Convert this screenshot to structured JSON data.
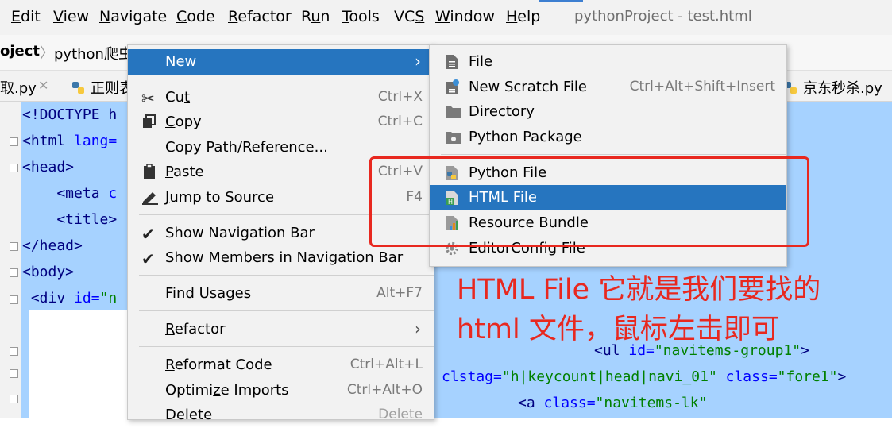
{
  "menubar": {
    "items": [
      {
        "pre": "",
        "u": "E",
        "post": "dit"
      },
      {
        "pre": "",
        "u": "V",
        "post": "iew"
      },
      {
        "pre": "",
        "u": "N",
        "post": "avigate"
      },
      {
        "pre": "",
        "u": "C",
        "post": "ode"
      },
      {
        "pre": "",
        "u": "R",
        "post": "efactor"
      },
      {
        "pre": "R",
        "u": "u",
        "post": "n"
      },
      {
        "pre": "",
        "u": "T",
        "post": "ools"
      },
      {
        "pre": "VC",
        "u": "S",
        "post": ""
      },
      {
        "pre": "",
        "u": "W",
        "post": "indow"
      },
      {
        "pre": "",
        "u": "H",
        "post": "elp"
      }
    ],
    "window_title": "pythonProject - test.html"
  },
  "navbar": {
    "project": "oject",
    "folder": "python爬虫"
  },
  "tabs": {
    "left_tab": "取.py",
    "mid_tab": "正则表",
    "right_tab": "京东秒杀.py"
  },
  "editor": {
    "lines": [
      {
        "a": "<!DOCTYPE h",
        "b": "",
        "c": ""
      },
      {
        "a": "<html",
        "b": " lang=",
        "c": ""
      },
      {
        "a": "<head>",
        "b": "",
        "c": ""
      },
      {
        "a": "    <meta",
        "b": " c",
        "c": ""
      },
      {
        "a": "    <title>",
        "b": "",
        "c": ""
      },
      {
        "a": "</head>",
        "b": "",
        "c": ""
      },
      {
        "a": "<body>",
        "b": "",
        "c": ""
      },
      {
        "a": " <div",
        "b": " id=",
        "c": "\"n"
      }
    ],
    "right_lines": [
      {
        "t1": "<ul",
        "t2": " id=",
        "t3": "\"navitems-group1\"",
        "t4": ">"
      },
      {
        "t1": "",
        "t2": "clstag=",
        "t3": "\"h|keycount|head|navi_01\"",
        "t4": " class=",
        "t5": "\"fore1\"",
        "t6": ">"
      },
      {
        "t1": "<a",
        "t2": " class=",
        "t3": "\"navitems-lk\"",
        "t4": ""
      }
    ]
  },
  "context_menu": {
    "items": [
      {
        "pre": "",
        "u": "N",
        "post": "ew",
        "shortcut": "",
        "icon": "none"
      },
      {
        "pre": "Cu",
        "u": "t",
        "post": "",
        "shortcut": "Ctrl+X",
        "icon": "scissors-icon"
      },
      {
        "pre": "",
        "u": "C",
        "post": "opy",
        "shortcut": "Ctrl+C",
        "icon": "copy-icon"
      },
      {
        "pre": "Copy Path/Reference...",
        "u": "",
        "post": "",
        "shortcut": "",
        "icon": "none"
      },
      {
        "pre": "",
        "u": "P",
        "post": "aste",
        "shortcut": "Ctrl+V",
        "icon": "clipboard-icon"
      },
      {
        "pre": "",
        "u": "J",
        "post": "ump to Source",
        "shortcut": "F4",
        "icon": "pencil-icon"
      },
      {
        "pre": "Show Navigation Bar",
        "u": "",
        "post": "",
        "shortcut": "",
        "icon": "check-icon"
      },
      {
        "pre": "Show Members in Navigation Bar",
        "u": "",
        "post": "",
        "shortcut": "",
        "icon": "check-icon"
      },
      {
        "pre": "Find ",
        "u": "U",
        "post": "sages",
        "shortcut": "Alt+F7",
        "icon": "none"
      },
      {
        "pre": "",
        "u": "R",
        "post": "efactor",
        "shortcut": "",
        "icon": "none"
      },
      {
        "pre": "",
        "u": "R",
        "post": "eformat Code",
        "shortcut": "Ctrl+Alt+L",
        "icon": "none"
      },
      {
        "pre": "Optimi",
        "u": "z",
        "post": "e Imports",
        "shortcut": "Ctrl+Alt+O",
        "icon": "none"
      },
      {
        "pre": "Delete",
        "u": "",
        "post": "",
        "shortcut": "Delete",
        "icon": "none"
      }
    ],
    "arrow": "›",
    "check": "✔"
  },
  "submenu": {
    "items": [
      {
        "label": "File",
        "shortcut": "",
        "icon": "file-icon"
      },
      {
        "label": "New Scratch File",
        "shortcut": "Ctrl+Alt+Shift+Insert",
        "icon": "scratch-file-icon"
      },
      {
        "label": "Directory",
        "shortcut": "",
        "icon": "folder-icon"
      },
      {
        "label": "Python Package",
        "shortcut": "",
        "icon": "package-icon"
      },
      {
        "label": "Python File",
        "shortcut": "",
        "icon": "python-file-icon"
      },
      {
        "label": "HTML File",
        "shortcut": "",
        "icon": "html-file-icon"
      },
      {
        "label": "Resource Bundle",
        "shortcut": "",
        "icon": "resource-bundle-icon"
      },
      {
        "label": "EditorConfig File",
        "shortcut": "",
        "icon": "gear-icon"
      }
    ]
  },
  "annotation": {
    "line1": "HTML File 它就是我们要找的",
    "line2": "html 文件，鼠标左击即可"
  },
  "colors": {
    "highlight": "#2675bf",
    "annotation_red": "#e8281f",
    "selection": "#a6d2ff"
  }
}
